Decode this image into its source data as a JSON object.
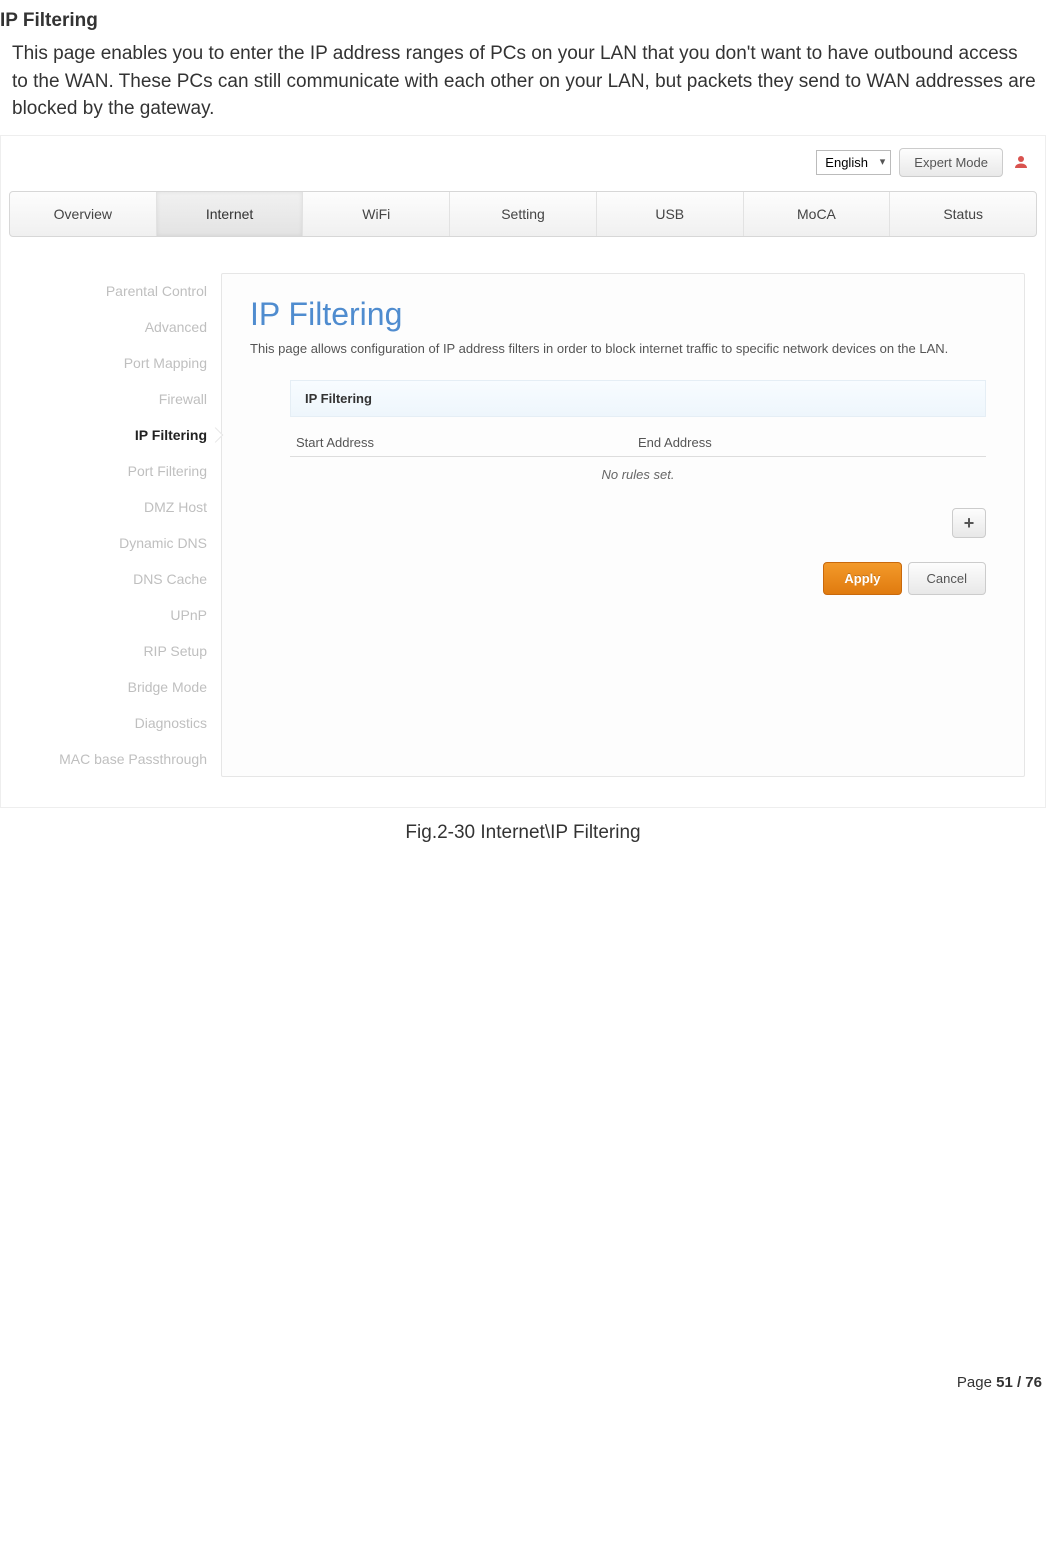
{
  "doc": {
    "title": "IP Filtering",
    "description": "This page enables you to enter the IP address ranges of PCs on your LAN that you don't want to have outbound access to the WAN. These PCs can still communicate with each other on your LAN, but packets they send to WAN addresses are blocked by the gateway.",
    "caption": "Fig.2-30 Internet\\IP Filtering",
    "footer_prefix": "Page ",
    "footer_page": "51 / 76"
  },
  "topbar": {
    "language": "English",
    "expert_mode": "Expert Mode"
  },
  "tabs": [
    "Overview",
    "Internet",
    "WiFi",
    "Setting",
    "USB",
    "MoCA",
    "Status"
  ],
  "tabs_active_index": 1,
  "sidebar": {
    "items": [
      "Parental Control",
      "Advanced",
      "Port Mapping",
      "Firewall",
      "IP Filtering",
      "Port Filtering",
      "DMZ Host",
      "Dynamic DNS",
      "DNS Cache",
      "UPnP",
      "RIP Setup",
      "Bridge Mode",
      "Diagnostics",
      "MAC base Passthrough"
    ],
    "active_index": 4
  },
  "panel": {
    "heading": "IP Filtering",
    "subdesc": "This page allows configuration of IP address filters in order to block internet traffic to specific network devices on the LAN.",
    "section_head": "IP Filtering",
    "col_start": "Start Address",
    "col_end": "End Address",
    "no_rules": "No rules set.",
    "add": "+",
    "apply": "Apply",
    "cancel": "Cancel"
  }
}
